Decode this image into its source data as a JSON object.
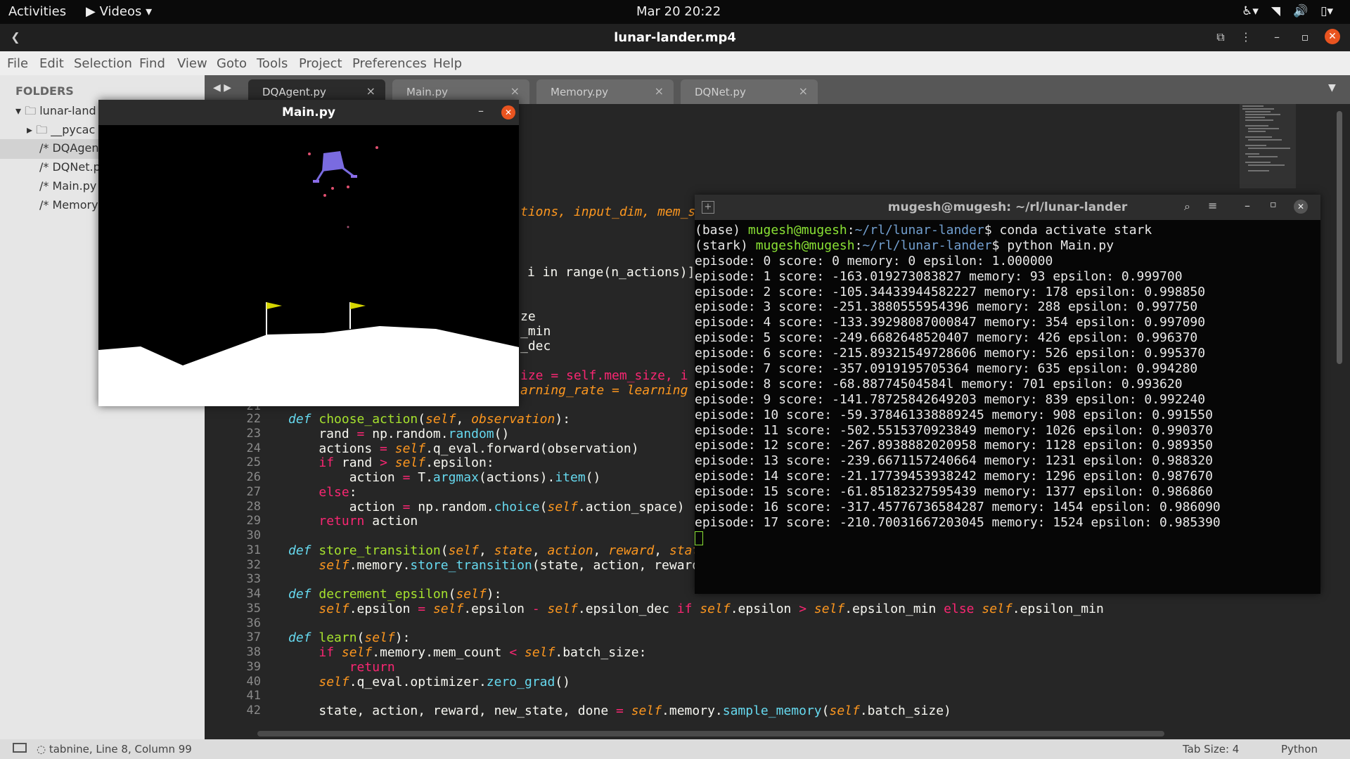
{
  "topbar": {
    "activities": "Activities",
    "app_menu": "Videos",
    "clock": "Mar 20  20:22"
  },
  "player": {
    "title": "lunar-lander.mp4"
  },
  "menu": [
    "File",
    "Edit",
    "Selection",
    "Find",
    "View",
    "Goto",
    "Tools",
    "Project",
    "Preferences",
    "Help"
  ],
  "sidebar": {
    "header": "FOLDERS",
    "items": [
      "lunar-land",
      "__pycac",
      "DQAgen",
      "DQNet.p",
      "Main.py",
      "Memory"
    ]
  },
  "tabs": [
    "DQAgent.py",
    "Main.py",
    "Memory.py",
    "DQNet.py"
  ],
  "game_window": {
    "title": "Main.py"
  },
  "terminal": {
    "title": "mugesh@mugesh: ~/rl/lunar-lander",
    "prompt_lines": [
      {
        "env": "(base) ",
        "user": "mugesh@mugesh",
        "sep": ":",
        "path": "~/rl/lunar-lander",
        "cmd": "$ conda activate stark"
      },
      {
        "env": "(stark) ",
        "user": "mugesh@mugesh",
        "sep": ":",
        "path": "~/rl/lunar-lander",
        "cmd": "$ python Main.py"
      }
    ],
    "output": [
      "episode: 0 score: 0 memory: 0 epsilon: 1.000000",
      "episode: 1 score: -163.019273083827 memory: 93 epsilon: 0.999700",
      "episode: 2 score: -105.34433944582227 memory: 178 epsilon: 0.998850",
      "episode: 3 score: -251.3880555954396 memory: 288 epsilon: 0.997750",
      "episode: 4 score: -133.39298087000847 memory: 354 epsilon: 0.997090",
      "episode: 5 score: -249.6682648520407 memory: 426 epsilon: 0.996370",
      "episode: 6 score: -215.89321549728606 memory: 526 epsilon: 0.995370",
      "episode: 7 score: -357.0919195705364 memory: 635 epsilon: 0.994280",
      "episode: 8 score: -68.88774504584l memory: 701 epsilon: 0.993620",
      "episode: 9 score: -141.78725842649203 memory: 839 epsilon: 0.992240",
      "episode: 10 score: -59.378461338889245 memory: 908 epsilon: 0.991550",
      "episode: 11 score: -502.5515370923849 memory: 1026 epsilon: 0.990370",
      "episode: 12 score: -267.8938882020958 memory: 1128 epsilon: 0.989350",
      "episode: 13 score: -239.6671157240664 memory: 1231 epsilon: 0.988320",
      "episode: 14 score: -21.17739453938242 memory: 1296 epsilon: 0.987670",
      "episode: 15 score: -61.85182327595439 memory: 1377 epsilon: 0.986860",
      "episode: 16 score: -317.45776736584287 memory: 1454 epsilon: 0.986090",
      "episode: 17 score: -210.70031667203045 memory: 1524 epsilon: 0.985390"
    ]
  },
  "editor": {
    "partial_lines": [
      "tions, input_dim, mem_s",
      "i in range(n_actions)]",
      "ze",
      "_min",
      "_dec",
      "ize = self.mem_size, i",
      "arning_rate = learning"
    ],
    "line_numbers": [
      "21",
      "22",
      "23",
      "24",
      "25",
      "26",
      "27",
      "28",
      "29",
      "30",
      "31",
      "32",
      "33",
      "34",
      "35",
      "36",
      "37",
      "38",
      "39",
      "40",
      "41",
      "42"
    ]
  },
  "status": {
    "left": "tabnine, Line 8, Column 99",
    "tab_size": "Tab Size: 4",
    "syntax": "Python"
  },
  "icons": [
    "play-icon",
    "caret-down-icon",
    "accessibility-icon",
    "wifi-icon",
    "volume-icon",
    "battery-icon",
    "back-icon",
    "search-icon",
    "hamburger-icon",
    "close-icon",
    "folder-icon",
    "file-icon"
  ]
}
